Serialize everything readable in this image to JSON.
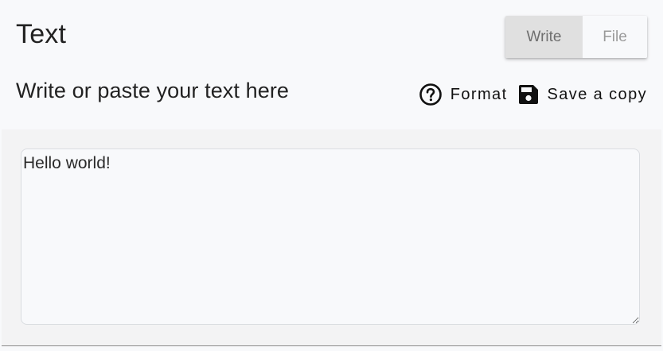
{
  "header": {
    "title": "Text"
  },
  "mode_toggle": {
    "options": [
      "Write",
      "File"
    ],
    "selected": "Write"
  },
  "section": {
    "heading": "Write or paste your text here"
  },
  "actions": {
    "format_label": "Format",
    "format_icon": "help-circle-icon",
    "save_label": "Save a copy",
    "save_icon": "floppy-disk-icon"
  },
  "editor": {
    "value": "Hello world!",
    "placeholder": ""
  },
  "colors": {
    "background": "#f8f9fb",
    "selected_toggle": "#e0e0e0",
    "editor_panel": "#f3f3f4"
  }
}
